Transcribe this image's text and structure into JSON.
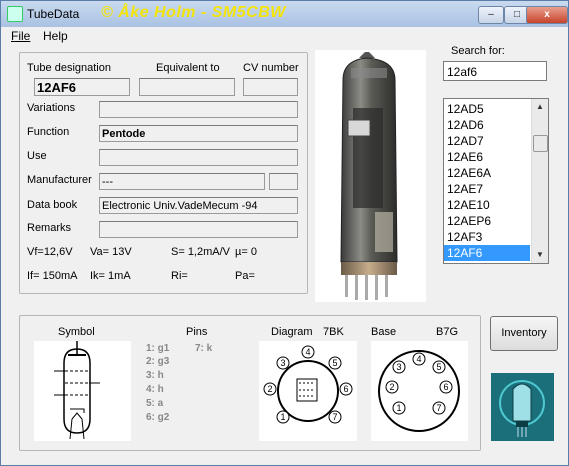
{
  "window": {
    "title": "TubeData",
    "copyright": "© Åke Holm - SM5CBW",
    "min": "–",
    "max": "□",
    "close": "x"
  },
  "menu": {
    "file": "File",
    "help": "Help"
  },
  "form": {
    "designation_label": "Tube designation",
    "equivalent_label": "Equivalent to",
    "cv_label": "CV number",
    "designation_value": "12AF6",
    "variations_label": "Variations",
    "function_label": "Function",
    "function_value": "Pentode",
    "use_label": "Use",
    "manufacturer_label": "Manufacturer",
    "manufacturer_value": "---",
    "databook_label": "Data book",
    "databook_value": "Electronic Univ.VadeMecum -94",
    "remarks_label": "Remarks",
    "vf": "Vf=12,6V",
    "va": "Va= 13V",
    "s": "S= 1,2mA/V",
    "mu": "µ=    0",
    "if": "If= 150mA",
    "ik": "Ik=  1mA",
    "ri": "Ri=",
    "pa": "Pa="
  },
  "search": {
    "label": "Search for:",
    "value": "12af6"
  },
  "list": {
    "items": [
      "12AD5",
      "12AD6",
      "12AD7",
      "12AE6",
      "12AE6A",
      "12AE7",
      "12AE10",
      "12AEP6",
      "12AF3",
      "12AF6"
    ],
    "selected_index": 9
  },
  "bottom": {
    "symbol_label": "Symbol",
    "pins_label": "Pins",
    "diagram_label": "Diagram",
    "diagram_code": "7BK",
    "base_label": "Base",
    "base_code": "B7G",
    "pins": [
      "1: g1",
      "2: g3",
      "3: h",
      "4: h",
      "5: a",
      "6: g2",
      "7: k"
    ],
    "diagram_pins": [
      "1",
      "2",
      "3",
      "4",
      "5",
      "6",
      "7"
    ],
    "base_pins": [
      "1",
      "2",
      "3",
      "4",
      "5",
      "6",
      "7"
    ]
  },
  "inventory_label": "Inventory",
  "colors": {
    "title_gradient": "#a9c1e2",
    "copyright": "#f4e40a",
    "selection": "#3399ff",
    "close_button": "#c7442b"
  }
}
